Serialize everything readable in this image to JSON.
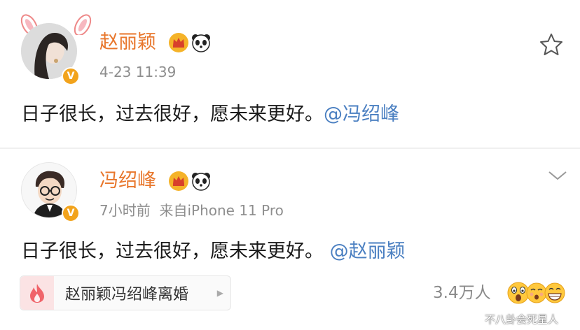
{
  "post1": {
    "author": "赵丽颖",
    "time": "4-23 11:39",
    "text": "日子很长，过去很好，愿未来更好。",
    "mention": "@冯绍峰",
    "star_icon": "star-outline-icon"
  },
  "post2": {
    "author": "冯绍峰",
    "time": "7小时前",
    "source": "来自iPhone 11 Pro",
    "text": "日子很长，过去很好，愿未来更好。",
    "mention": "@赵丽颖",
    "chevron_icon": "chevron-down-icon"
  },
  "topic": {
    "label": "赵丽颖冯绍峰离婚",
    "icon": "fire-icon"
  },
  "reactions": {
    "count": "3.4万人",
    "emojis": [
      "shocked-emoji",
      "wow-emoji",
      "grin-emoji"
    ]
  },
  "watermark": "不八卦会死星人",
  "colors": {
    "name": "#e8762b",
    "mention": "#4a7fc1",
    "meta": "#8e8e8e",
    "vip_badge": "#f2a31c"
  }
}
